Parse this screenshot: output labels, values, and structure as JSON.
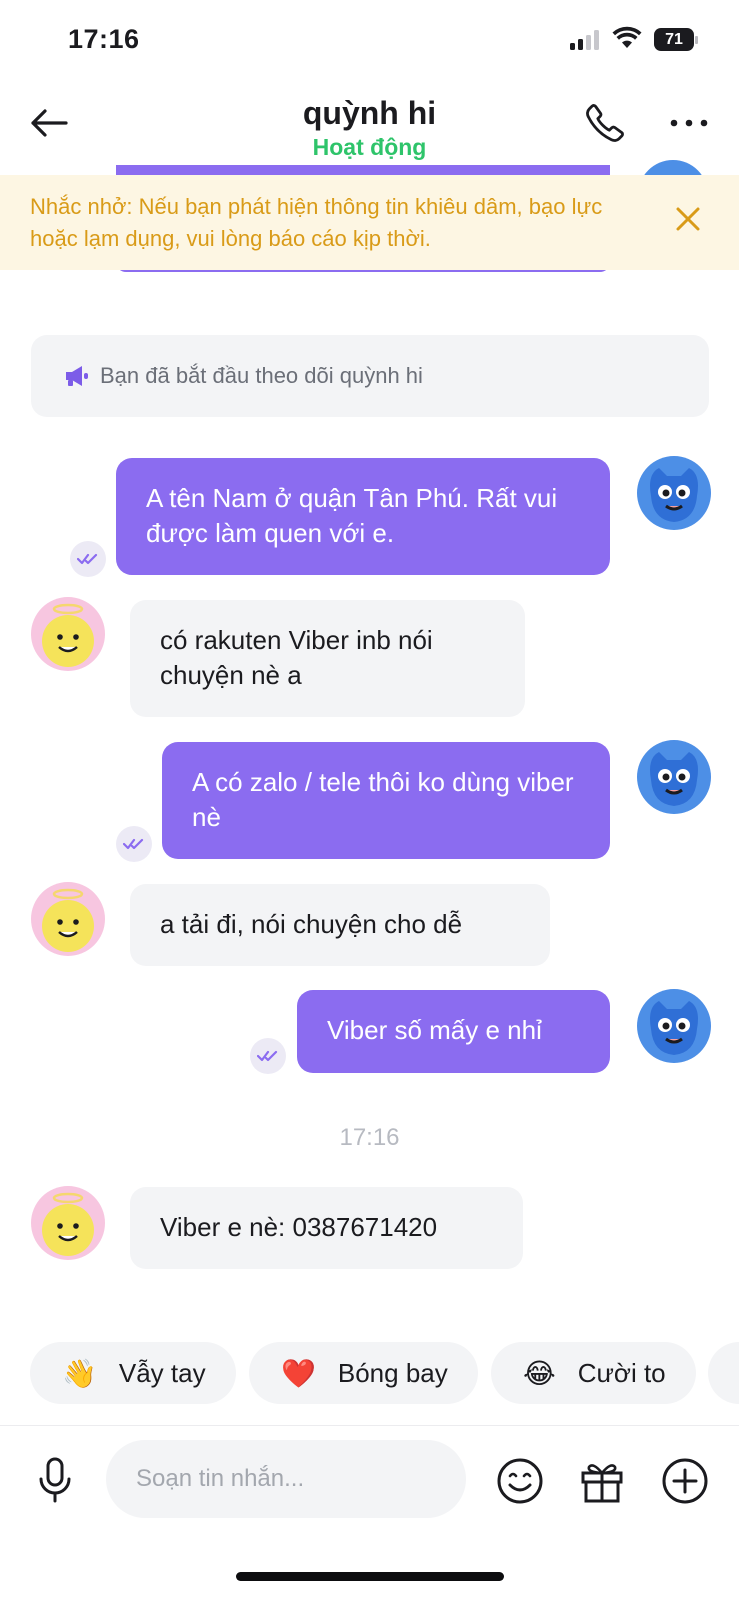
{
  "status_bar": {
    "time": "17:16",
    "battery": "71"
  },
  "header": {
    "title": "quỳnh hi",
    "status": "Hoạt động",
    "status_color": "#2ec46a"
  },
  "banner": {
    "text": "Nhắc nhở: Nếu bạn phát hiện thông tin khiêu dâm, bạo lực hoặc lạm dụng, vui lòng báo cáo kịp thời."
  },
  "notice": {
    "text": "Bạn đã bắt đầu theo dõi quỳnh hi"
  },
  "messages": [
    {
      "direction": "out",
      "text": "A tên Nam ở quận Tân Phú. Rất vui được làm quen với e."
    },
    {
      "direction": "in",
      "text": "có rakuten Viber inb nói chuyện nè a"
    },
    {
      "direction": "out",
      "text": "A có zalo / tele thôi ko dùng viber nè"
    },
    {
      "direction": "in",
      "text": "a tải đi, nói chuyện cho dễ"
    },
    {
      "direction": "out",
      "text": "Viber số mấy e nhỉ"
    },
    {
      "direction": "in",
      "text": "Viber e nè: 0387671420"
    }
  ],
  "timestamp": "17:16",
  "quick_replies": [
    {
      "emoji": "👋",
      "label": "Vẫy tay"
    },
    {
      "emoji": "❤️",
      "label": "Bóng bay"
    },
    {
      "emoji": "😂",
      "label": "Cười to"
    }
  ],
  "composer": {
    "placeholder": "Soạn tin nhắn..."
  },
  "colors": {
    "accent_purple": "#8b6cf0",
    "banner_bg": "#fdf6e3",
    "banner_text": "#d99b18",
    "incoming_bubble": "#f3f4f6"
  },
  "icons": [
    "back-arrow-icon",
    "phone-icon",
    "more-icon",
    "close-icon",
    "megaphone-icon",
    "read-receipt-icon",
    "mic-icon",
    "emoji-icon",
    "gift-icon",
    "plus-icon"
  ]
}
